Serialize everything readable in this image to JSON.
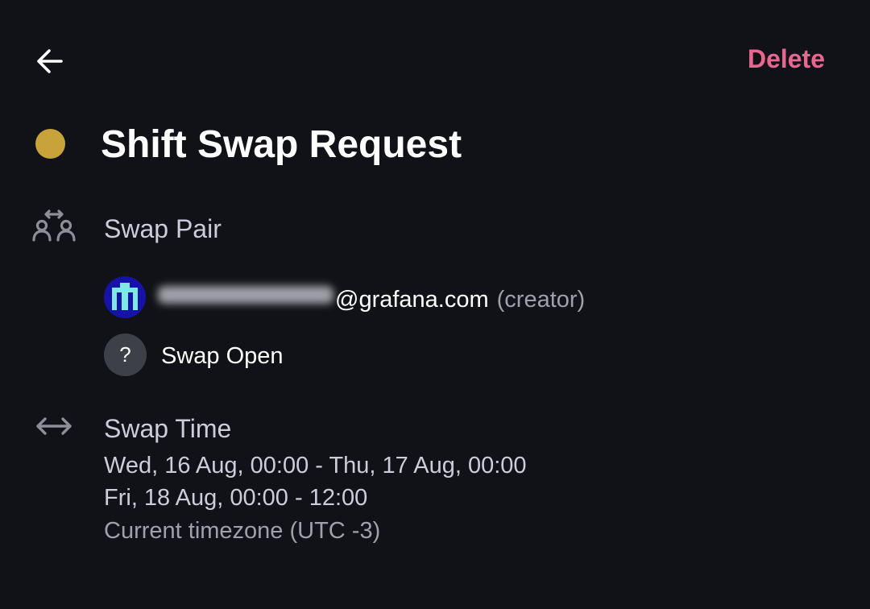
{
  "header": {
    "back_icon": "arrow-left-icon",
    "delete_label": "Delete",
    "delete_color": "#e8668f"
  },
  "request": {
    "title": "Shift Swap Request",
    "status_color": "#c7a33a"
  },
  "swap_pair": {
    "icon": "users-swap-icon",
    "label": "Swap Pair",
    "creator": {
      "avatar": "user-avatar",
      "email_domain": "@grafana.com",
      "role": "(creator)"
    },
    "beneficiary": {
      "icon": "question-mark-icon",
      "placeholder": "?",
      "label": "Swap Open"
    }
  },
  "swap_time": {
    "icon": "arrows-horizontal-icon",
    "label": "Swap Time",
    "ranges": [
      "Wed, 16 Aug, 00:00 - Thu, 17 Aug, 00:00",
      "Fri, 18 Aug, 00:00 - 12:00"
    ],
    "timezone": "Current timezone (UTC -3)"
  }
}
